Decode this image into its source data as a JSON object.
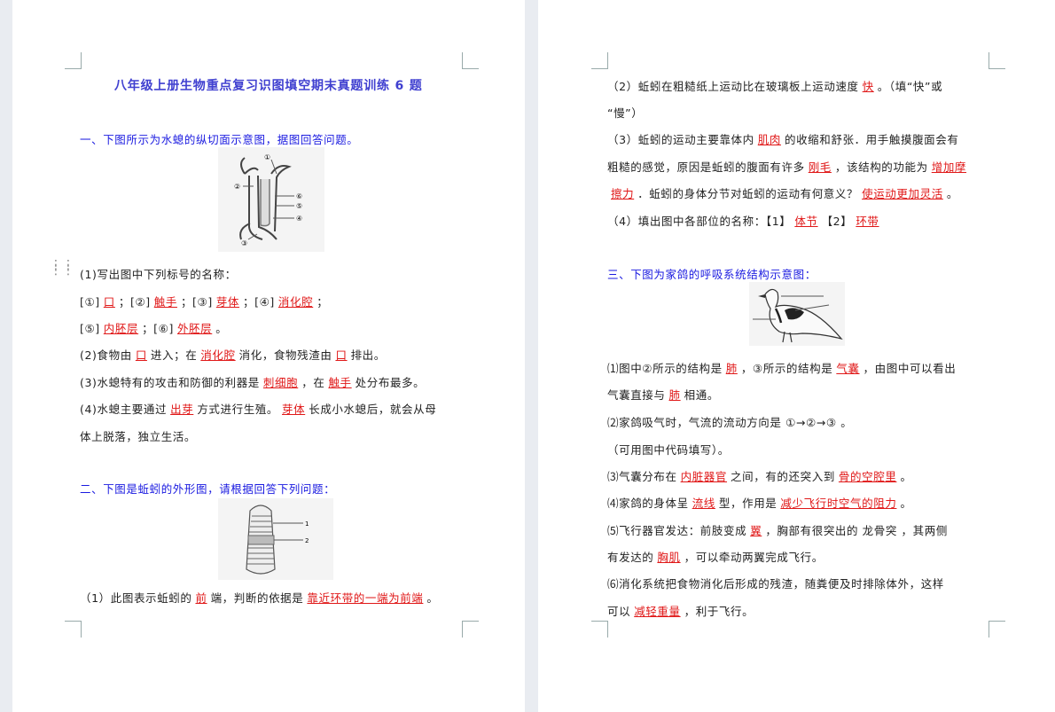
{
  "title": "八年级上册生物重点复习识图填空期末真题训练 6 题",
  "q1": {
    "heading": "一、下图所示为水螅的纵切面示意图，据图回答问题。",
    "fig_labels": [
      "①",
      "②",
      "③",
      "④",
      "⑤",
      "⑥"
    ],
    "sub1": "(1)写出图中下列标号的名称：",
    "row1": {
      "p1": "[①]",
      "a1": "口",
      "s1": "；[②]",
      "a2": "触手",
      "s2": "；[③]",
      "a3": "芽体",
      "s3": "；[④]",
      "a4": "消化腔",
      "s4": "；"
    },
    "row2": {
      "p1": "[⑤]",
      "a5": "内胚层",
      "s1": "；[⑥]",
      "a6": "外胚层",
      "s2": "。"
    },
    "l2": {
      "t1": "(2)食物由",
      "a1": "口",
      "t2": "进入；在",
      "a2": "消化腔",
      "t3": "消化，食物残渣由",
      "a3": "口",
      "t4": "排出。"
    },
    "l3": {
      "t1": "(3)水螅特有的攻击和防御的利器是",
      "a1": "刺细胞",
      "t2": "，在",
      "a2": "触手",
      "t3": "处分布最多。"
    },
    "l4": {
      "t1": "(4)水螅主要通过",
      "a1": "出芽",
      "t2": "方式进行生殖。",
      "a2": "芽体",
      "t3": "长成小水螅后，就会从母"
    },
    "l5": "体上脱落，独立生活。"
  },
  "q2": {
    "heading": "二、下图是蚯蚓的外形图，请根据回答下列问题：",
    "fig_labels": [
      "1",
      "2"
    ],
    "l1": {
      "t1": "（1）此图表示蚯蚓的",
      "a1": "前",
      "t2": "端，判断的依据是",
      "a2": "靠近环带的一端为前端",
      "t3": "。"
    },
    "l2": {
      "t1": "（2）蚯蚓在粗糙纸上运动比在玻璃板上运动速度",
      "a1": "快",
      "t2": "。（填“快”或"
    },
    "l3": "“慢”）",
    "l4": {
      "t1": "（3）蚯蚓的运动主要靠体内",
      "a1": "肌肉",
      "t2": "的收缩和舒张．用手触摸腹面会有"
    },
    "l5": {
      "t1": "粗糙的感觉，原因是蚯蚓的腹面有许多",
      "a1": "刚毛",
      "t2": "，该结构的功能为",
      "a2": "增加摩"
    },
    "l6": {
      "a1": "擦力",
      "t1": "．蚯蚓的身体分节对蚯蚓的运动有何意义？",
      "a2": "使运动更加灵活",
      "t2": "。"
    },
    "l7": {
      "t1": "（4）填出图中各部位的名称：【1】",
      "a1": "体节",
      "t2": "【2】",
      "a2": "环带"
    }
  },
  "q3": {
    "heading": "三、下图为家鸽的呼吸系统结构示意图：",
    "l1": {
      "t1": "⑴图中②所示的结构是",
      "a1": "肺",
      "t2": "，③所示的结构是",
      "a2": "气囊",
      "t3": "，由图中可以看出"
    },
    "l2": {
      "t1": "气囊直接与",
      "a1": "肺",
      "t2": "相通。"
    },
    "l3": "⑵家鸽吸气时，气流的流动方向是  ①→②→③  。",
    "l4": "（可用图中代码填写）。",
    "l5": {
      "t1": "⑶气囊分布在",
      "a1": "内脏器官",
      "t2": "之间，有的还突入到",
      "a2": "骨的空腔里",
      "t3": "。"
    },
    "l6": {
      "t1": "⑷家鸽的身体呈",
      "a1": "流线",
      "t2": "型，作用是",
      "a2": "减少飞行时空气的阻力",
      "t3": "。"
    },
    "l7": {
      "t1": "⑸飞行器官发达：前肢变成",
      "a1": "翼",
      "t2": "，胸部有很突出的  龙骨突 ，其两侧"
    },
    "l8": {
      "t1": "有发达的",
      "a1": "胸肌",
      "t2": "，可以牵动两翼完成飞行。"
    },
    "l9": "⑹消化系统把食物消化后形成的残渣，随粪便及时排除体外，这样",
    "l10": {
      "t1": "可以",
      "a1": "减轻重量",
      "t2": "，利于飞行。"
    }
  }
}
